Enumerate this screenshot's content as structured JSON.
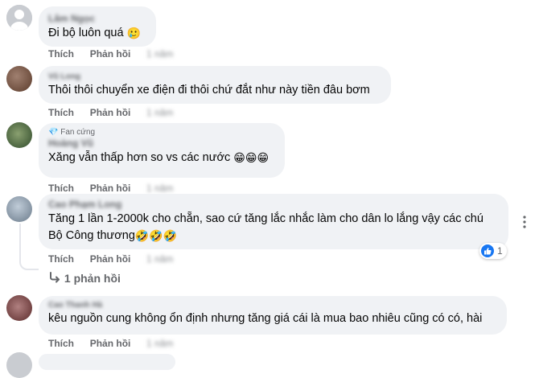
{
  "comments": [
    {
      "author": "Lâm Ngọc",
      "text": "Đi bộ luôn quá",
      "emoji": "🥲",
      "like_label": "Thích",
      "reply_label": "Phản hồi",
      "time": "1 năm",
      "avatar_color": "#c9ccd1"
    },
    {
      "author": "Vũ Long",
      "text": "Thôi thôi chuyển xe điện đi thôi chứ đắt như này tiền đâu bơm",
      "like_label": "Thích",
      "reply_label": "Phản hồi",
      "time": "1 năm",
      "avatar_color": "#7a5a4a"
    },
    {
      "badge": "Fan cứng",
      "author": "Hoàng Vũ",
      "text": "Xăng vẫn thấp hơn so vs các nước",
      "emoji": "😁😁😁",
      "like_label": "Thích",
      "reply_label": "Phản hồi",
      "time": "1 năm",
      "avatar_color": "#4a6a3a"
    },
    {
      "author": "Cao Phạm Long",
      "text_line1": "Tăng 1 lần 1-2000k cho chẵn, sao cứ tăng lắc nhắc làm cho dân lo lắng vậy các chú",
      "text_line2": "Bộ Công thương",
      "emoji": "🤣🤣🤣",
      "like_label": "Thích",
      "reply_label": "Phản hồi",
      "time": "1 năm",
      "reaction_count": "1",
      "replies_label": "1 phản hồi",
      "avatar_color": "#9aa8b8"
    },
    {
      "author": "Cao Thanh Hà",
      "text": "kêu nguồn cung không ổn định nhưng tăng giá cái là mua bao nhiêu cũng có có, hài",
      "like_label": "Thích",
      "reply_label": "Phản hồi",
      "time": "1 năm",
      "avatar_color": "#8a5a5a"
    }
  ],
  "colors": {
    "bubble": "#f0f2f5",
    "secondary_text": "#65676b",
    "like_blue": "#1877f2"
  }
}
